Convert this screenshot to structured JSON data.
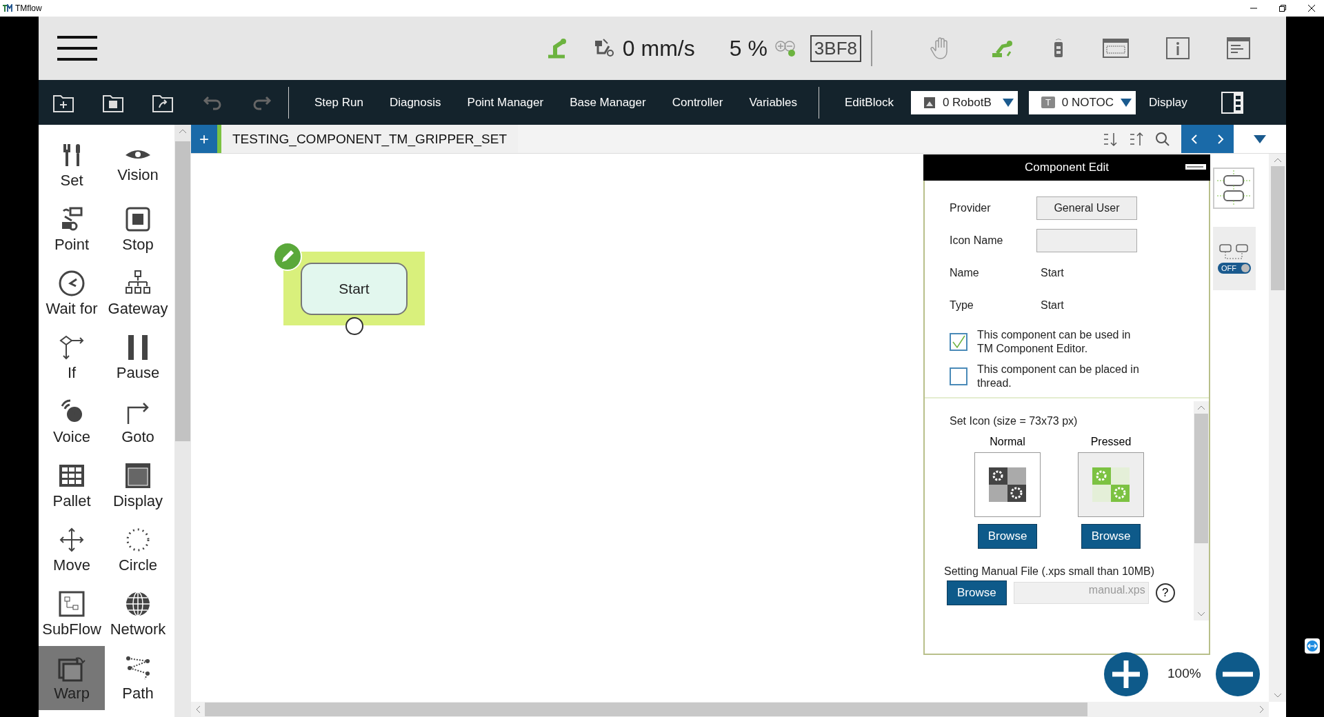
{
  "window": {
    "title": "TMflow"
  },
  "status": {
    "speed": "0 mm/s",
    "percent": "5 %",
    "code": "3BF8"
  },
  "toolbar": {
    "items": [
      "Step Run",
      "Diagnosis",
      "Point Manager",
      "Base Manager",
      "Controller",
      "Variables"
    ],
    "edit_block": "EditBlock",
    "base": "0 RobotB",
    "tool_badge": "T",
    "tool": "0 NOTOC",
    "display": "Display"
  },
  "tab": {
    "add": "+",
    "title": "TESTING_COMPONENT_TM_GRIPPER_SET"
  },
  "palette": [
    {
      "kind": "set",
      "label": "Set",
      "selected": false
    },
    {
      "kind": "vision",
      "label": "Vision",
      "selected": false
    },
    {
      "kind": "point",
      "label": "Point",
      "selected": false
    },
    {
      "kind": "stop",
      "label": "Stop",
      "selected": false
    },
    {
      "kind": "wait",
      "label": "Wait for",
      "selected": false
    },
    {
      "kind": "gateway",
      "label": "Gateway",
      "selected": false
    },
    {
      "kind": "if",
      "label": "If",
      "selected": false
    },
    {
      "kind": "pause",
      "label": "Pause",
      "selected": false
    },
    {
      "kind": "voice",
      "label": "Voice",
      "selected": false
    },
    {
      "kind": "goto",
      "label": "Goto",
      "selected": false
    },
    {
      "kind": "pallet",
      "label": "Pallet",
      "selected": false
    },
    {
      "kind": "display",
      "label": "Display",
      "selected": false
    },
    {
      "kind": "move",
      "label": "Move",
      "selected": false
    },
    {
      "kind": "circle",
      "label": "Circle",
      "selected": false
    },
    {
      "kind": "subflow",
      "label": "SubFlow",
      "selected": false
    },
    {
      "kind": "network",
      "label": "Network",
      "selected": false
    },
    {
      "kind": "warp",
      "label": "Warp",
      "selected": true
    },
    {
      "kind": "path",
      "label": "Path",
      "selected": false
    }
  ],
  "canvas": {
    "node": "Start"
  },
  "component_edit": {
    "title": "Component Edit",
    "fields": [
      {
        "kind": "button",
        "label": "Provider",
        "value": "General User"
      },
      {
        "kind": "input",
        "label": "Icon Name"
      },
      {
        "kind": "text",
        "label": "Name",
        "value": "Start"
      },
      {
        "kind": "text",
        "label": "Type",
        "value": "Start"
      }
    ],
    "checks": [
      {
        "label": "This component can be used in TM Component Editor.",
        "checked": true
      },
      {
        "label": "This component can be placed in thread.",
        "checked": false
      }
    ],
    "set_icon": "Set Icon (size = 73x73 px)",
    "icons": [
      {
        "label": "Normal",
        "browse": "Browse",
        "pressed": false
      },
      {
        "label": "Pressed",
        "browse": "Browse",
        "pressed": true
      }
    ],
    "manual_label": "Setting Manual File (.xps small than 10MB)",
    "manual_browse": "Browse",
    "manual_file": "manual.xps",
    "help": "?"
  },
  "thread_toggle": {
    "label": "OFF",
    "on": false
  },
  "zoom": "100%"
}
